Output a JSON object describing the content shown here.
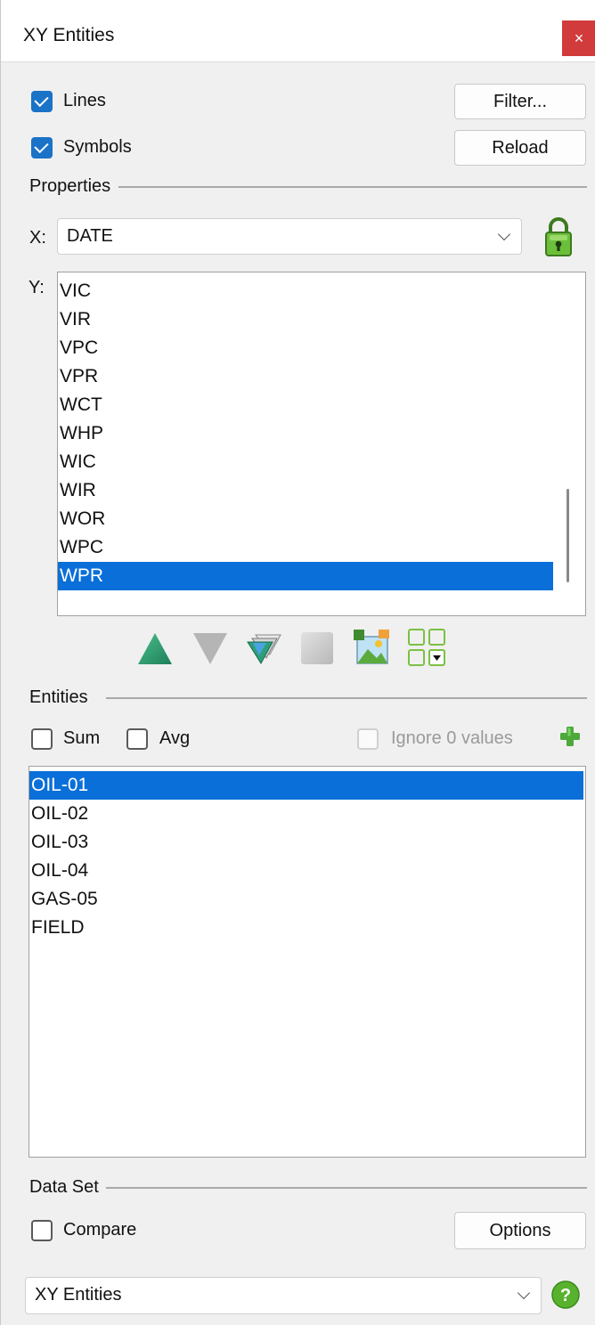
{
  "window": {
    "title": "XY Entities",
    "close_glyph": "×"
  },
  "options": {
    "lines_label": "Lines",
    "lines_checked": true,
    "symbols_label": "Symbols",
    "symbols_checked": true,
    "filter_label": "Filter...",
    "reload_label": "Reload"
  },
  "properties": {
    "section_label": "Properties",
    "x_label": "X:",
    "x_value": "DATE",
    "y_label": "Y:",
    "y_items": [
      "VIC",
      "VIR",
      "VPC",
      "VPR",
      "WCT",
      "WHP",
      "WIC",
      "WIR",
      "WOR",
      "WPC",
      "WPR"
    ],
    "y_selected": "WPR",
    "lock_icon": "lock-icon"
  },
  "toolbar": {
    "icons": [
      "move-up-icon",
      "move-down-icon",
      "sort-icon",
      "blank-square-icon",
      "image-export-icon",
      "grid-layout-icon"
    ],
    "colors": {
      "up": "#2fa37a",
      "down": "#b5b5b5",
      "grid": "#7cc043"
    }
  },
  "entities": {
    "section_label": "Entities",
    "sum_label": "Sum",
    "sum_checked": false,
    "avg_label": "Avg",
    "avg_checked": false,
    "ignore_label": "Ignore 0 values",
    "ignore_checked": false,
    "ignore_disabled": true,
    "add_icon": "add-icon",
    "items": [
      "OIL-01",
      "OIL-02",
      "OIL-03",
      "OIL-04",
      "GAS-05",
      "FIELD"
    ],
    "selected": "OIL-01"
  },
  "dataset": {
    "section_label": "Data Set",
    "compare_label": "Compare",
    "compare_checked": false,
    "options_label": "Options",
    "combo_value": "XY Entities",
    "help_icon": "help-icon",
    "help_glyph": "?"
  },
  "colors": {
    "selection": "#0a6fd8",
    "checkbox": "#1a73c7",
    "close": "#d13b3b",
    "lock": "#6cbf3a",
    "help": "#58b22d"
  }
}
